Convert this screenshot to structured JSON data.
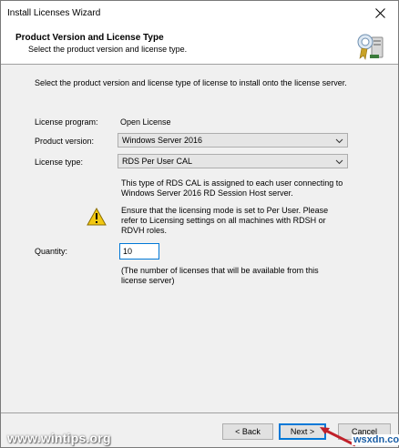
{
  "window": {
    "title": "Install Licenses Wizard"
  },
  "header": {
    "title": "Product Version and License Type",
    "subtitle": "Select the product version and license type."
  },
  "content": {
    "intro": "Select the product version and license type of license to install onto the license server.",
    "license_program": {
      "label": "License program:",
      "value": "Open License"
    },
    "product_version": {
      "label": "Product version:",
      "value": "Windows Server 2016"
    },
    "license_type": {
      "label": "License type:",
      "value": "RDS Per User CAL"
    },
    "description": "This type of RDS CAL is assigned to each user connecting to Windows Server 2016 RD Session Host server.",
    "warning": "Ensure that the licensing mode is set to Per User. Please refer to Licensing settings on all machines with RDSH or RDVH roles.",
    "quantity": {
      "label": "Quantity:",
      "value": "10",
      "note": "(The number of licenses that will be available from this license server)"
    }
  },
  "buttons": {
    "back": "< Back",
    "next": "Next >",
    "cancel": "Cancel"
  },
  "watermark": {
    "left": "www.wintips.org",
    "right": "wsxdn.com"
  },
  "colors": {
    "accent": "#0078d7",
    "warning": "#f2c811",
    "arrow": "#c0202a"
  }
}
